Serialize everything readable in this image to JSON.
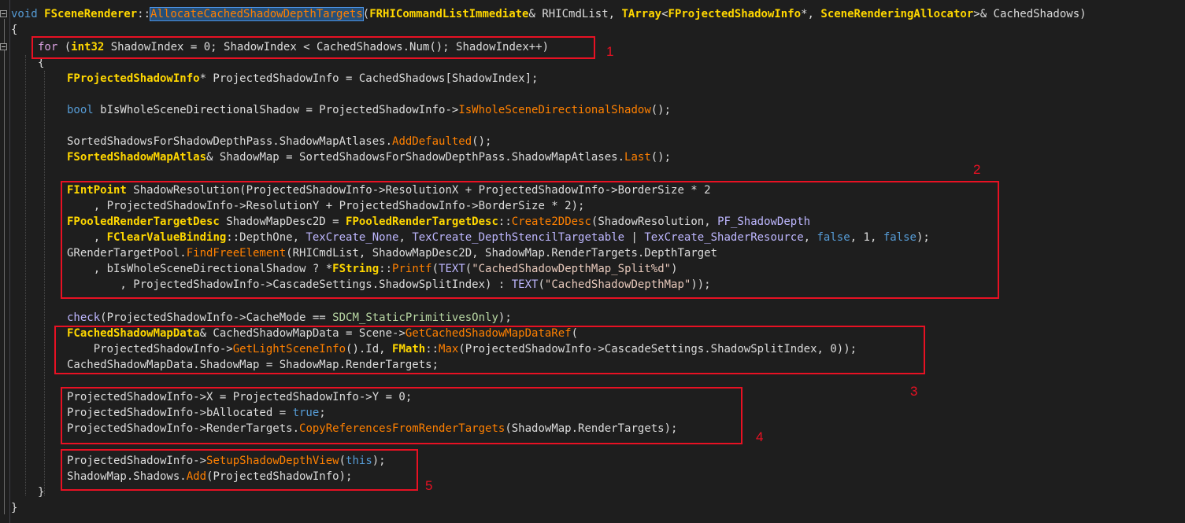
{
  "code_lines": [
    [
      [
        "void",
        "kw"
      ],
      [
        " ",
        ""
      ],
      [
        "FSceneRenderer",
        "ty"
      ],
      [
        "::",
        ""
      ],
      [
        "AllocateCachedShadowDepthTargets",
        "fn sel"
      ],
      [
        "(",
        ""
      ],
      [
        "FRHICommandListImmediate",
        "ty"
      ],
      [
        "& RHICmdList, ",
        ""
      ],
      [
        "TArray",
        "ty"
      ],
      [
        "<",
        ""
      ],
      [
        "FProjectedShadowInfo",
        "ty"
      ],
      [
        "*, ",
        ""
      ],
      [
        "SceneRenderingAllocator",
        "ty"
      ],
      [
        ">& CachedShadows)",
        ""
      ]
    ],
    [
      [
        "{",
        ""
      ]
    ],
    [
      [
        "for",
        "ctl"
      ],
      [
        " (",
        ""
      ],
      [
        "int32",
        "ty"
      ],
      [
        " ShadowIndex = 0; ShadowIndex < CachedShadows.Num(); ShadowIndex++)",
        ""
      ]
    ],
    [
      [
        "{",
        ""
      ]
    ],
    [
      [
        "FProjectedShadowInfo",
        "ty"
      ],
      [
        "* ProjectedShadowInfo = CachedShadows[ShadowIndex];",
        ""
      ]
    ],
    [],
    [
      [
        "bool",
        "kw"
      ],
      [
        " bIsWholeSceneDirectionalShadow = ProjectedShadowInfo->",
        ""
      ],
      [
        "IsWholeSceneDirectionalShadow",
        "fn"
      ],
      [
        "();",
        ""
      ]
    ],
    [],
    [
      [
        "SortedShadowsForShadowDepthPass.ShadowMapAtlases.",
        ""
      ],
      [
        "AddDefaulted",
        "fn"
      ],
      [
        "();",
        ""
      ]
    ],
    [
      [
        "FSortedShadowMapAtlas",
        "ty"
      ],
      [
        "& ShadowMap = SortedShadowsForShadowDepthPass.ShadowMapAtlases.",
        ""
      ],
      [
        "Last",
        "fn"
      ],
      [
        "();",
        ""
      ]
    ],
    [],
    [
      [
        "FIntPoint",
        "ty"
      ],
      [
        " ShadowResolution(ProjectedShadowInfo->ResolutionX + ProjectedShadowInfo->BorderSize * 2",
        ""
      ]
    ],
    [
      [
        "    , ProjectedShadowInfo->ResolutionY + ProjectedShadowInfo->BorderSize * 2);",
        ""
      ]
    ],
    [
      [
        "FPooledRenderTargetDesc",
        "ty"
      ],
      [
        " ShadowMapDesc2D = ",
        ""
      ],
      [
        "FPooledRenderTargetDesc",
        "ty"
      ],
      [
        "::",
        ""
      ],
      [
        "Create2DDesc",
        "fn"
      ],
      [
        "(ShadowResolution, ",
        ""
      ],
      [
        "PF_ShadowDepth",
        "mac"
      ]
    ],
    [
      [
        "    , ",
        ""
      ],
      [
        "FClearValueBinding",
        "ty"
      ],
      [
        "::DepthOne, ",
        ""
      ],
      [
        "TexCreate_None",
        "mac"
      ],
      [
        ", ",
        ""
      ],
      [
        "TexCreate_DepthStencilTargetable",
        "mac"
      ],
      [
        " | ",
        ""
      ],
      [
        "TexCreate_ShaderResource",
        "mac"
      ],
      [
        ", ",
        ""
      ],
      [
        "false",
        "kw"
      ],
      [
        ", 1, ",
        ""
      ],
      [
        "false",
        "kw"
      ],
      [
        ");",
        ""
      ]
    ],
    [
      [
        "GRenderTargetPool.",
        ""
      ],
      [
        "FindFreeElement",
        "fn"
      ],
      [
        "(RHICmdList, ShadowMapDesc2D, ShadowMap.RenderTargets.DepthTarget",
        ""
      ]
    ],
    [
      [
        "    , bIsWholeSceneDirectionalShadow ? *",
        ""
      ],
      [
        "FString",
        "ty"
      ],
      [
        "::",
        ""
      ],
      [
        "Printf",
        "fn"
      ],
      [
        "(",
        ""
      ],
      [
        "TEXT",
        "mac"
      ],
      [
        "(",
        ""
      ],
      [
        "\"CachedShadowDepthMap_Split%d\"",
        "str"
      ],
      [
        ")",
        ""
      ]
    ],
    [
      [
        "        , ProjectedShadowInfo->CascadeSettings.ShadowSplitIndex) : ",
        ""
      ],
      [
        "TEXT",
        "mac"
      ],
      [
        "(",
        ""
      ],
      [
        "\"CachedShadowDepthMap\"",
        "str"
      ],
      [
        "));",
        ""
      ]
    ],
    [],
    [
      [
        "check",
        "mac"
      ],
      [
        "(ProjectedShadowInfo->CacheMode == ",
        ""
      ],
      [
        "SDCM_StaticPrimitivesOnly",
        "en"
      ],
      [
        ");",
        ""
      ]
    ],
    [
      [
        "FCachedShadowMapData",
        "ty"
      ],
      [
        "& CachedShadowMapData = Scene->",
        ""
      ],
      [
        "GetCachedShadowMapDataRef",
        "fn"
      ],
      [
        "(",
        ""
      ]
    ],
    [
      [
        "    ProjectedShadowInfo->",
        ""
      ],
      [
        "GetLightSceneInfo",
        "fn"
      ],
      [
        "().Id, ",
        ""
      ],
      [
        "FMath",
        "ty"
      ],
      [
        "::",
        ""
      ],
      [
        "Max",
        "fn"
      ],
      [
        "(ProjectedShadowInfo->CascadeSettings.ShadowSplitIndex, 0));",
        ""
      ]
    ],
    [
      [
        "CachedShadowMapData.ShadowMap = ShadowMap.RenderTargets;",
        ""
      ]
    ],
    [],
    [
      [
        "ProjectedShadowInfo->X = ProjectedShadowInfo->Y = 0;",
        ""
      ]
    ],
    [
      [
        "ProjectedShadowInfo->bAllocated = ",
        ""
      ],
      [
        "true",
        "kw"
      ],
      [
        ";",
        ""
      ]
    ],
    [
      [
        "ProjectedShadowInfo->RenderTargets.",
        ""
      ],
      [
        "CopyReferencesFromRenderTargets",
        "fn"
      ],
      [
        "(ShadowMap.RenderTargets);",
        ""
      ]
    ],
    [],
    [
      [
        "ProjectedShadowInfo->",
        ""
      ],
      [
        "SetupShadowDepthView",
        "fn"
      ],
      [
        "(",
        ""
      ],
      [
        "this",
        "kw"
      ],
      [
        ");",
        ""
      ]
    ],
    [
      [
        "ShadowMap.Shadows.",
        ""
      ],
      [
        "Add",
        "fn"
      ],
      [
        "(ProjectedShadowInfo);",
        ""
      ]
    ],
    [
      [
        "}",
        ""
      ]
    ],
    [],
    [
      [
        "}",
        ""
      ]
    ]
  ],
  "annotations": {
    "label_1": "1",
    "label_2": "2",
    "label_3": "3",
    "label_4": "4",
    "label_5": "5"
  },
  "colors": {
    "editor_background": "#1e1e1e",
    "annotation_red": "#e81123",
    "keyword_blue": "#569cd6",
    "type_yellow": "#ffd700",
    "function_orange": "#ff8000",
    "macro_purple": "#beb7ff",
    "selection_blue": "#264f78"
  },
  "icons": [
    "fold-collapse-icon"
  ]
}
